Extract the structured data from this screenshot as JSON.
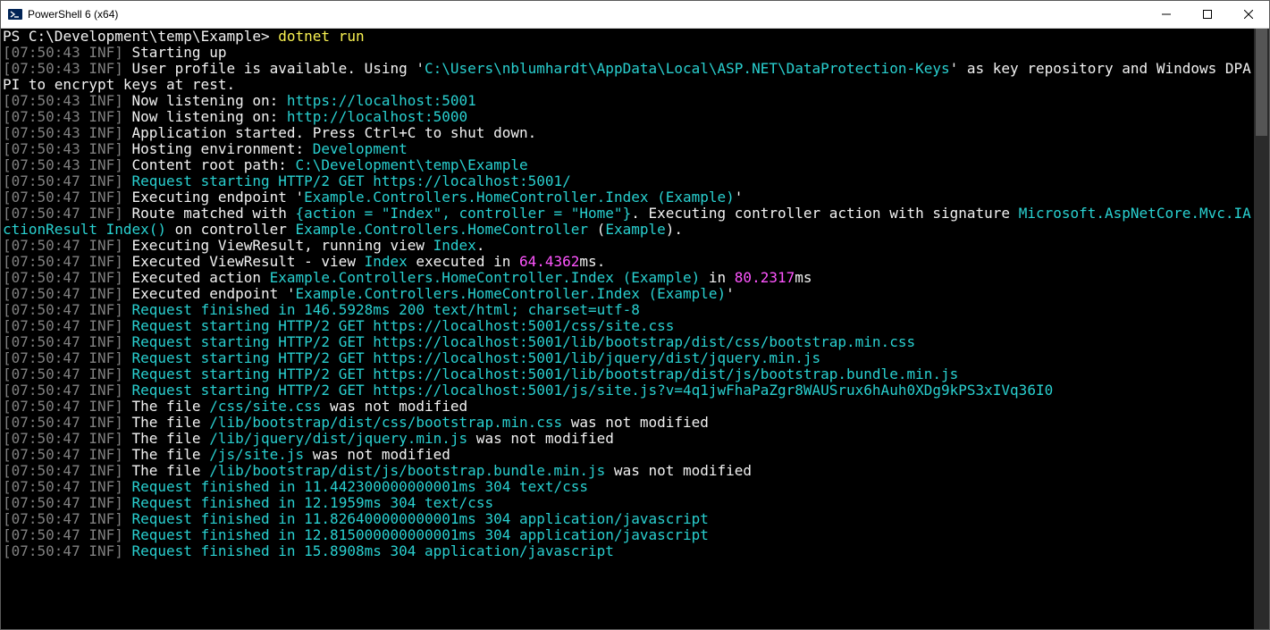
{
  "window": {
    "title": "PowerShell 6 (x64)"
  },
  "prompt": {
    "ps": "PS ",
    "path": "C:\\Development\\temp\\Example",
    "gt": "> ",
    "command": "dotnet run"
  },
  "lines": [
    {
      "segs": [
        {
          "c": "gr",
          "t": "[07:50:43 INF]"
        },
        {
          "c": "w",
          "t": " Starting up"
        }
      ]
    },
    {
      "segs": [
        {
          "c": "gr",
          "t": "[07:50:43 INF]"
        },
        {
          "c": "w",
          "t": " User profile is available. Using '"
        },
        {
          "c": "cy",
          "t": "C:\\Users\\nblumhardt\\AppData\\Local\\ASP.NET\\DataProtection-Keys"
        },
        {
          "c": "w",
          "t": "' as key repository and Windows DPAPI to encrypt keys at rest."
        }
      ]
    },
    {
      "segs": [
        {
          "c": "gr",
          "t": "[07:50:43 INF]"
        },
        {
          "c": "w",
          "t": " Now listening on: "
        },
        {
          "c": "cy",
          "t": "https://localhost:5001"
        }
      ]
    },
    {
      "segs": [
        {
          "c": "gr",
          "t": "[07:50:43 INF]"
        },
        {
          "c": "w",
          "t": " Now listening on: "
        },
        {
          "c": "cy",
          "t": "http://localhost:5000"
        }
      ]
    },
    {
      "segs": [
        {
          "c": "gr",
          "t": "[07:50:43 INF]"
        },
        {
          "c": "w",
          "t": " Application started. Press Ctrl+C to shut down."
        }
      ]
    },
    {
      "segs": [
        {
          "c": "gr",
          "t": "[07:50:43 INF]"
        },
        {
          "c": "w",
          "t": " Hosting environment: "
        },
        {
          "c": "cy",
          "t": "Development"
        }
      ]
    },
    {
      "segs": [
        {
          "c": "gr",
          "t": "[07:50:43 INF]"
        },
        {
          "c": "w",
          "t": " Content root path: "
        },
        {
          "c": "cy",
          "t": "C:\\Development\\temp\\Example"
        }
      ]
    },
    {
      "segs": [
        {
          "c": "gr",
          "t": "[07:50:47 INF]"
        },
        {
          "c": "w",
          "t": " "
        },
        {
          "c": "cy",
          "t": "Request starting HTTP/2 GET https://localhost:5001/"
        }
      ]
    },
    {
      "segs": [
        {
          "c": "gr",
          "t": "[07:50:47 INF]"
        },
        {
          "c": "w",
          "t": " Executing endpoint '"
        },
        {
          "c": "cy",
          "t": "Example.Controllers.HomeController.Index (Example)"
        },
        {
          "c": "w",
          "t": "'"
        }
      ]
    },
    {
      "segs": [
        {
          "c": "gr",
          "t": "[07:50:47 INF]"
        },
        {
          "c": "w",
          "t": " Route matched with "
        },
        {
          "c": "cy",
          "t": "{action = \"Index\", controller = \"Home\"}"
        },
        {
          "c": "w",
          "t": ". Executing controller action with signature "
        },
        {
          "c": "cy",
          "t": "Microsoft.AspNetCore.Mvc.IActionResult Index()"
        },
        {
          "c": "w",
          "t": " on controller "
        },
        {
          "c": "cy",
          "t": "Example.Controllers.HomeController"
        },
        {
          "c": "w",
          "t": " ("
        },
        {
          "c": "cy",
          "t": "Example"
        },
        {
          "c": "w",
          "t": ")."
        }
      ]
    },
    {
      "segs": [
        {
          "c": "gr",
          "t": "[07:50:47 INF]"
        },
        {
          "c": "w",
          "t": " Executing ViewResult, running view "
        },
        {
          "c": "cy",
          "t": "Index"
        },
        {
          "c": "w",
          "t": "."
        }
      ]
    },
    {
      "segs": [
        {
          "c": "gr",
          "t": "[07:50:47 INF]"
        },
        {
          "c": "w",
          "t": " Executed ViewResult - view "
        },
        {
          "c": "cy",
          "t": "Index"
        },
        {
          "c": "w",
          "t": " executed in "
        },
        {
          "c": "mg",
          "t": "64.4362"
        },
        {
          "c": "w",
          "t": "ms."
        }
      ]
    },
    {
      "segs": [
        {
          "c": "gr",
          "t": "[07:50:47 INF]"
        },
        {
          "c": "w",
          "t": " Executed action "
        },
        {
          "c": "cy",
          "t": "Example.Controllers.HomeController.Index (Example)"
        },
        {
          "c": "w",
          "t": " in "
        },
        {
          "c": "mg",
          "t": "80.2317"
        },
        {
          "c": "w",
          "t": "ms"
        }
      ]
    },
    {
      "segs": [
        {
          "c": "gr",
          "t": "[07:50:47 INF]"
        },
        {
          "c": "w",
          "t": " Executed endpoint '"
        },
        {
          "c": "cy",
          "t": "Example.Controllers.HomeController.Index (Example)"
        },
        {
          "c": "w",
          "t": "'"
        }
      ]
    },
    {
      "segs": [
        {
          "c": "gr",
          "t": "[07:50:47 INF]"
        },
        {
          "c": "w",
          "t": " "
        },
        {
          "c": "cy",
          "t": "Request finished in 146.5928ms 200 text/html; charset=utf-8"
        }
      ]
    },
    {
      "segs": [
        {
          "c": "gr",
          "t": "[07:50:47 INF]"
        },
        {
          "c": "w",
          "t": " "
        },
        {
          "c": "cy",
          "t": "Request starting HTTP/2 GET https://localhost:5001/css/site.css"
        }
      ]
    },
    {
      "segs": [
        {
          "c": "gr",
          "t": "[07:50:47 INF]"
        },
        {
          "c": "w",
          "t": " "
        },
        {
          "c": "cy",
          "t": "Request starting HTTP/2 GET https://localhost:5001/lib/bootstrap/dist/css/bootstrap.min.css"
        }
      ]
    },
    {
      "segs": [
        {
          "c": "gr",
          "t": "[07:50:47 INF]"
        },
        {
          "c": "w",
          "t": " "
        },
        {
          "c": "cy",
          "t": "Request starting HTTP/2 GET https://localhost:5001/lib/jquery/dist/jquery.min.js"
        }
      ]
    },
    {
      "segs": [
        {
          "c": "gr",
          "t": "[07:50:47 INF]"
        },
        {
          "c": "w",
          "t": " "
        },
        {
          "c": "cy",
          "t": "Request starting HTTP/2 GET https://localhost:5001/lib/bootstrap/dist/js/bootstrap.bundle.min.js"
        }
      ]
    },
    {
      "segs": [
        {
          "c": "gr",
          "t": "[07:50:47 INF]"
        },
        {
          "c": "w",
          "t": " "
        },
        {
          "c": "cy",
          "t": "Request starting HTTP/2 GET https://localhost:5001/js/site.js?v=4q1jwFhaPaZgr8WAUSrux6hAuh0XDg9kPS3xIVq36I0"
        }
      ]
    },
    {
      "segs": [
        {
          "c": "gr",
          "t": "[07:50:47 INF]"
        },
        {
          "c": "w",
          "t": " The file "
        },
        {
          "c": "cy",
          "t": "/css/site.css"
        },
        {
          "c": "w",
          "t": " was not modified"
        }
      ]
    },
    {
      "segs": [
        {
          "c": "gr",
          "t": "[07:50:47 INF]"
        },
        {
          "c": "w",
          "t": " The file "
        },
        {
          "c": "cy",
          "t": "/lib/bootstrap/dist/css/bootstrap.min.css"
        },
        {
          "c": "w",
          "t": " was not modified"
        }
      ]
    },
    {
      "segs": [
        {
          "c": "gr",
          "t": "[07:50:47 INF]"
        },
        {
          "c": "w",
          "t": " The file "
        },
        {
          "c": "cy",
          "t": "/lib/jquery/dist/jquery.min.js"
        },
        {
          "c": "w",
          "t": " was not modified"
        }
      ]
    },
    {
      "segs": [
        {
          "c": "gr",
          "t": "[07:50:47 INF]"
        },
        {
          "c": "w",
          "t": " The file "
        },
        {
          "c": "cy",
          "t": "/js/site.js"
        },
        {
          "c": "w",
          "t": " was not modified"
        }
      ]
    },
    {
      "segs": [
        {
          "c": "gr",
          "t": "[07:50:47 INF]"
        },
        {
          "c": "w",
          "t": " The file "
        },
        {
          "c": "cy",
          "t": "/lib/bootstrap/dist/js/bootstrap.bundle.min.js"
        },
        {
          "c": "w",
          "t": " was not modified"
        }
      ]
    },
    {
      "segs": [
        {
          "c": "gr",
          "t": "[07:50:47 INF]"
        },
        {
          "c": "w",
          "t": " "
        },
        {
          "c": "cy",
          "t": "Request finished in 11.442300000000001ms 304 text/css"
        }
      ]
    },
    {
      "segs": [
        {
          "c": "gr",
          "t": "[07:50:47 INF]"
        },
        {
          "c": "w",
          "t": " "
        },
        {
          "c": "cy",
          "t": "Request finished in 12.1959ms 304 text/css"
        }
      ]
    },
    {
      "segs": [
        {
          "c": "gr",
          "t": "[07:50:47 INF]"
        },
        {
          "c": "w",
          "t": " "
        },
        {
          "c": "cy",
          "t": "Request finished in 11.826400000000001ms 304 application/javascript"
        }
      ]
    },
    {
      "segs": [
        {
          "c": "gr",
          "t": "[07:50:47 INF]"
        },
        {
          "c": "w",
          "t": " "
        },
        {
          "c": "cy",
          "t": "Request finished in 12.815000000000001ms 304 application/javascript"
        }
      ]
    },
    {
      "segs": [
        {
          "c": "gr",
          "t": "[07:50:47 INF]"
        },
        {
          "c": "w",
          "t": " "
        },
        {
          "c": "cy",
          "t": "Request finished in 15.8908ms 304 application/javascript"
        }
      ]
    }
  ],
  "scroll": {
    "thumbTop": 0,
    "thumbHeight": 120
  }
}
